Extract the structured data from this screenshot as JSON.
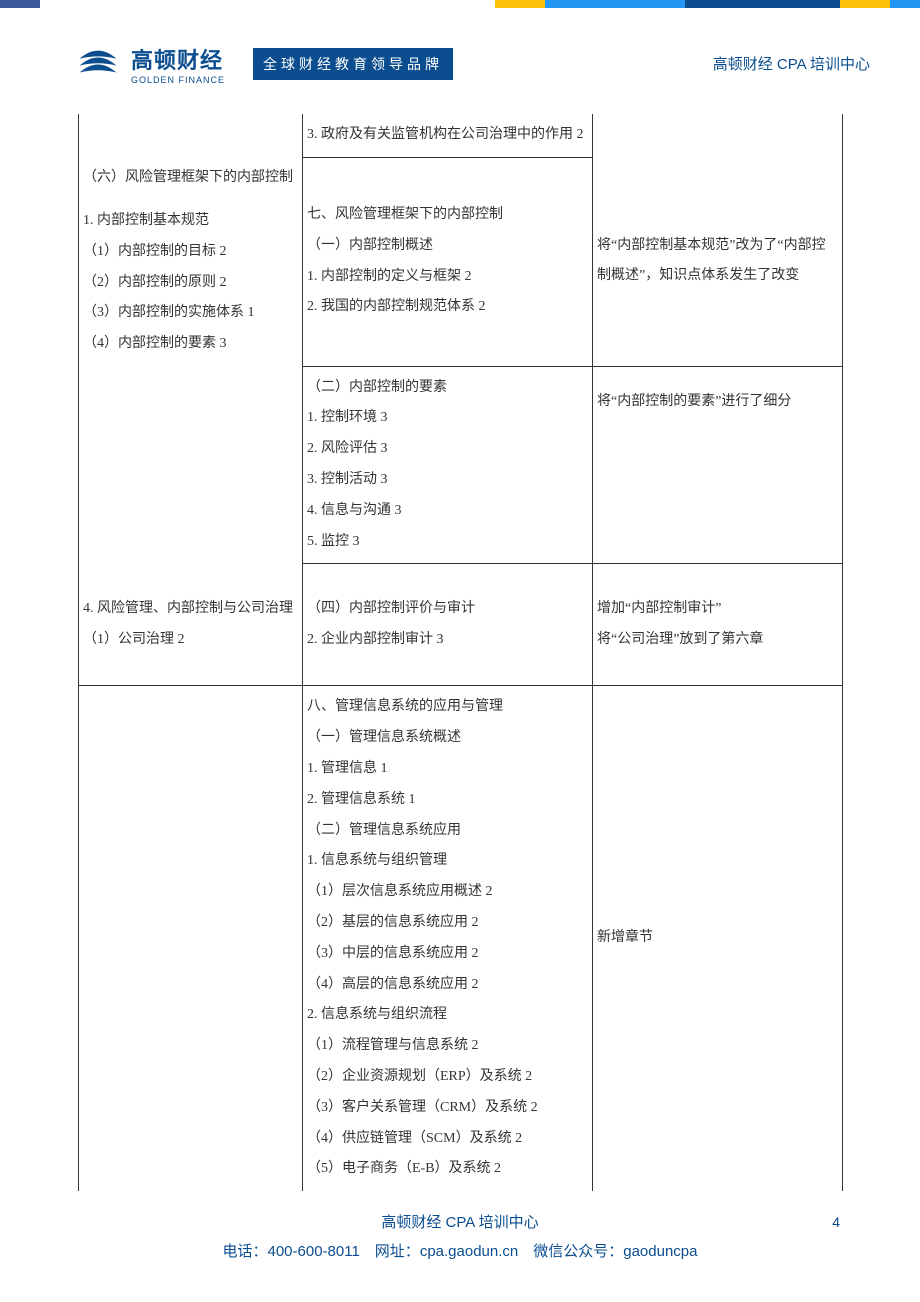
{
  "header": {
    "logo_cn": "高顿财经",
    "logo_en": "GOLDEN FINANCE",
    "tagline": "全球财经教育领导品牌",
    "right": "高顿财经 CPA 培训中心"
  },
  "table": {
    "r1c2": "3. 政府及有关监管机构在公司治理中的作用 2",
    "r2c1": "（六）风险管理框架下的内部控制",
    "r3c1_1": "1. 内部控制基本规范",
    "r3c1_2": "（1）内部控制的目标 2",
    "r3c1_3": "（2）内部控制的原则 2",
    "r3c1_4": "（3）内部控制的实施体系 1",
    "r3c1_5": "（4）内部控制的要素 3",
    "r3c2_1": "七、风险管理框架下的内部控制",
    "r3c2_2": "（一）内部控制概述",
    "r3c2_3": "1. 内部控制的定义与框架 2",
    "r3c2_4": "2. 我国的内部控制规范体系 2",
    "r3c3": "将“内部控制基本规范”改为了“内部控制概述”，知识点体系发生了改变",
    "r4c2_1": "（二）内部控制的要素",
    "r4c2_2": "1. 控制环境 3",
    "r4c2_3": "2. 风险评估 3",
    "r4c2_4": "3. 控制活动 3",
    "r4c2_5": "4. 信息与沟通 3",
    "r4c2_6": "5. 监控 3",
    "r4c3": "将“内部控制的要素”进行了细分",
    "r5c1_1": "4. 风险管理、内部控制与公司治理",
    "r5c1_2": "（1）公司治理 2",
    "r5c2_1": "（四）内部控制评价与审计",
    "r5c2_2": "2. 企业内部控制审计 3",
    "r5c3_1": "增加“内部控制审计”",
    "r5c3_2": "将“公司治理”放到了第六章",
    "r6c2_1": "八、管理信息系统的应用与管理",
    "r6c2_2": "（一）管理信息系统概述",
    "r6c2_3": "1. 管理信息 1",
    "r6c2_4": "2. 管理信息系统 1",
    "r6c2_5": "（二）管理信息系统应用",
    "r6c2_6": "1. 信息系统与组织管理",
    "r6c2_7": "（1）层次信息系统应用概述 2",
    "r6c2_8": "（2）基层的信息系统应用 2",
    "r6c2_9": "（3）中层的信息系统应用 2",
    "r6c2_10": "（4）高层的信息系统应用 2",
    "r6c2_11": "2. 信息系统与组织流程",
    "r6c2_12": "（1）流程管理与信息系统 2",
    "r6c2_13": "（2）企业资源规划（ERP）及系统 2",
    "r6c2_14": "（3）客户关系管理（CRM）及系统 2",
    "r6c2_15": "（4）供应链管理（SCM）及系统 2",
    "r6c2_16": "（5）电子商务（E-B）及系统 2",
    "r6c3": "新增章节"
  },
  "footer": {
    "line1": "高顿财经 CPA 培训中心",
    "line2_prefix": "电话：400-600-8011　网址：",
    "line2_link": "cpa.gaodun.cn",
    "line2_suffix": "　微信公众号：gaoduncpa",
    "page": "4"
  }
}
